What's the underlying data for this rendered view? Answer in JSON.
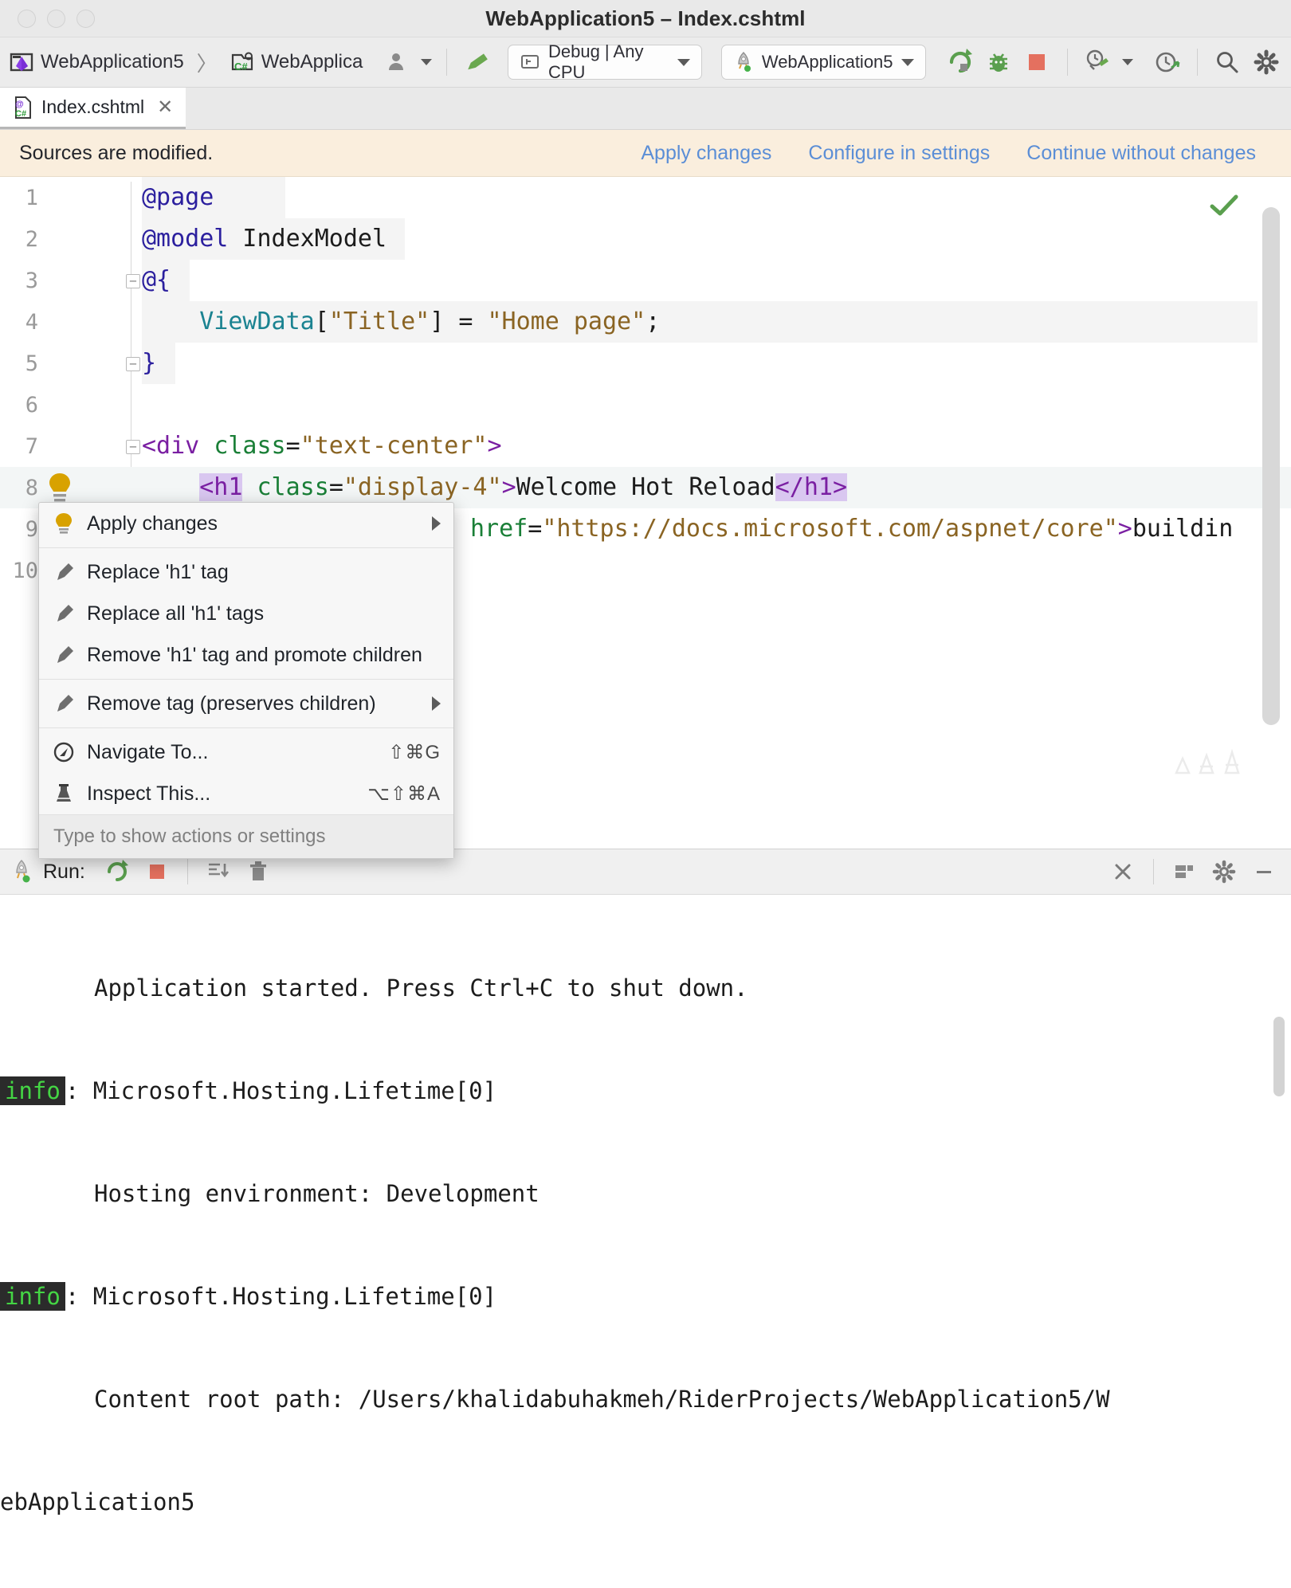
{
  "window": {
    "title": "WebApplication5 – Index.cshtml",
    "traffic_lights": [
      "close",
      "minimize",
      "zoom"
    ]
  },
  "toolbar": {
    "breadcrumb": [
      {
        "icon": "rider-solution-icon",
        "label": "WebApplication5"
      },
      {
        "icon": "csharp-project-icon",
        "label": "WebApplica"
      }
    ],
    "separator_glyph": "〉",
    "user_menu_icon": "user-avatar-icon",
    "build_icon": "hammer-icon",
    "configuration": {
      "icon": "config-icon",
      "label": "Debug | Any CPU"
    },
    "run_config": {
      "icon": "rocket-icon",
      "label": "WebApplication5"
    },
    "buttons": [
      {
        "icon": "run-icon",
        "name": "run-button"
      },
      {
        "icon": "debug-bug-icon",
        "name": "debug-button"
      },
      {
        "icon": "stop-square-icon",
        "name": "stop-button"
      },
      {
        "icon": "profiler-icon",
        "name": "profile-button"
      },
      {
        "icon": "chevron-down-icon",
        "name": "profile-dropdown"
      },
      {
        "icon": "hot-reload-icon",
        "name": "hot-reload-button"
      },
      {
        "icon": "search-icon",
        "name": "search-everywhere-button"
      },
      {
        "icon": "gear-icon",
        "name": "settings-button"
      }
    ]
  },
  "tabs": [
    {
      "icon": "razor-cshtml-icon",
      "label": "Index.cshtml",
      "close_glyph": "✕",
      "active": true
    }
  ],
  "banner": {
    "message": "Sources are modified.",
    "actions": [
      "Apply changes",
      "Configure in settings",
      "Continue without changes"
    ]
  },
  "editor": {
    "status_icon": "green-check-icon",
    "lines": [
      {
        "num": "1",
        "text": "@page"
      },
      {
        "num": "2",
        "text": "@model IndexModel"
      },
      {
        "num": "3",
        "text": "@{",
        "fold": "-"
      },
      {
        "num": "4",
        "text": "    ViewData[\"Title\"] = \"Home page\";"
      },
      {
        "num": "5",
        "text": "}",
        "fold": "-"
      },
      {
        "num": "6",
        "text": ""
      },
      {
        "num": "7",
        "text": "<div class=\"text-center\">",
        "fold": "-"
      },
      {
        "num": "8",
        "text": "    <h1 class=\"display-4\">Welcome Hot Reload</h1>",
        "bulb": true,
        "highlighted": true
      },
      {
        "num": "9",
        "text": "        href=\"https://docs.microsoft.com/aspnet/core\">buildin"
      },
      {
        "num": "10",
        "text": ""
      }
    ]
  },
  "context_menu": {
    "groups": [
      {
        "items": [
          {
            "icon": "lightbulb-icon",
            "label": "Apply changes",
            "submenu": true,
            "shortcut": ""
          }
        ]
      },
      {
        "items": [
          {
            "icon": "hammer-icon",
            "label": "Replace 'h1' tag",
            "submenu": false,
            "shortcut": ""
          },
          {
            "icon": "hammer-icon",
            "label": "Replace all 'h1' tags",
            "submenu": false,
            "shortcut": ""
          },
          {
            "icon": "hammer-icon",
            "label": "Remove 'h1' tag and promote children",
            "submenu": false,
            "shortcut": ""
          }
        ]
      },
      {
        "items": [
          {
            "icon": "hammer-icon",
            "label": "Remove tag (preserves children)",
            "submenu": true,
            "shortcut": ""
          }
        ]
      },
      {
        "items": [
          {
            "icon": "navigate-icon",
            "label": "Navigate To...",
            "submenu": false,
            "shortcut": "⇧⌘G"
          },
          {
            "icon": "inspect-icon",
            "label": "Inspect This...",
            "submenu": false,
            "shortcut": "⌥⇧⌘A"
          }
        ]
      }
    ],
    "footer_hint": "Type to show actions or settings"
  },
  "run_panel": {
    "title": "Run:",
    "title_icon": "rocket-icon",
    "left_buttons": [
      {
        "icon": "rerun-icon",
        "name": "rerun-button"
      },
      {
        "icon": "stop-square-icon",
        "name": "stop-button"
      },
      {
        "icon": "scroll-to-end-icon",
        "name": "scroll-to-end-button"
      },
      {
        "icon": "trash-icon",
        "name": "clear-all-button"
      }
    ],
    "right_buttons": [
      {
        "icon": "close-icon",
        "name": "close-tool-window-button"
      },
      {
        "icon": "layout-icon",
        "name": "layout-settings-button"
      },
      {
        "icon": "gear-icon",
        "name": "run-settings-button"
      },
      {
        "icon": "minimize-icon",
        "name": "hide-tool-window-button"
      }
    ],
    "console_lines": [
      {
        "badge": "",
        "indent": true,
        "text": "Application started. Press Ctrl+C to shut down."
      },
      {
        "badge": "info",
        "indent": false,
        "text": ": Microsoft.Hosting.Lifetime[0]"
      },
      {
        "badge": "",
        "indent": true,
        "text": "Hosting environment: Development"
      },
      {
        "badge": "info",
        "indent": false,
        "text": ": Microsoft.Hosting.Lifetime[0]"
      },
      {
        "badge": "",
        "indent": true,
        "text": "Content root path: /Users/khalidabuhakmeh/RiderProjects/WebApplication5/W"
      },
      {
        "badge": "",
        "indent": false,
        "text": "ebApplication5"
      }
    ]
  },
  "colors": {
    "banner_bg": "#faeedd",
    "link": "#5b8ed6",
    "run_green": "#5a9f4e",
    "stop_red": "#e4705f",
    "keyword": "#0033b3",
    "string": "#8a6423",
    "tag": "#7a1fa2",
    "attribute": "#1a7f37",
    "selection": "#d9c7f0",
    "console_info": "#44d544"
  }
}
